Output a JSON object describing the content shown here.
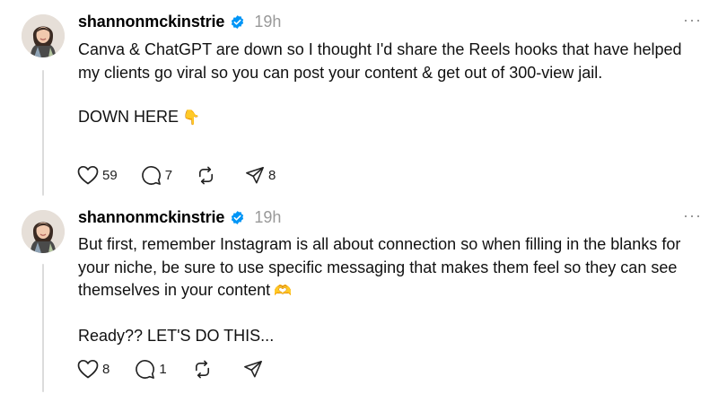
{
  "posts": [
    {
      "username": "shannonmckinstrie",
      "timestamp": "19h",
      "more": "···",
      "paragraphs": [
        "Canva & ChatGPT are down so I thought I'd share the Reels hooks that have helped my clients go viral so you can post your content & get out of 300-view jail.",
        "DOWN HERE"
      ],
      "emoji": "👇",
      "likes": "59",
      "replies": "7",
      "reposts": "",
      "shares": "8"
    },
    {
      "username": "shannonmckinstrie",
      "timestamp": "19h",
      "more": "···",
      "paragraphs": [
        "But first, remember Instagram is all about connection so when filling in the blanks for your niche, be sure to use specific messaging that makes them feel so they can see themselves in your content",
        "Ready?? LET'S DO THIS..."
      ],
      "emoji": "🫶",
      "likes": "8",
      "replies": "1",
      "reposts": "",
      "shares": ""
    }
  ],
  "colors": {
    "verified": "#0095f6",
    "muted": "#999999",
    "thread_line": "#dcdcdc"
  }
}
